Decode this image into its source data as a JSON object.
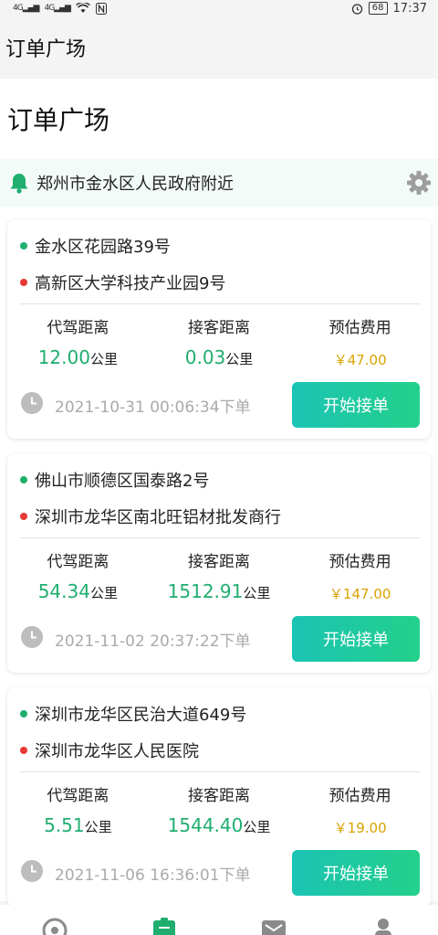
{
  "status": {
    "net1": "4G",
    "net2": "4G",
    "battery": "68",
    "time": "17:37"
  },
  "appbar": {
    "title": "订单广场"
  },
  "page": {
    "title": "订单广场"
  },
  "location": {
    "text": "郑州市金水区人民政府附近"
  },
  "labels": {
    "drive_distance": "代驾距离",
    "pickup_distance": "接客距离",
    "estimated_fee": "预估费用",
    "unit": "公里",
    "accept": "开始接单"
  },
  "orders": [
    {
      "from": "金水区花园路39号",
      "to": "高新区大学科技产业园9号",
      "drive": "12.00",
      "pickup": "0.03",
      "fee": "￥47.00",
      "time": "2021-10-31 00:06:34下单"
    },
    {
      "from": "佛山市顺德区国泰路2号",
      "to": "深圳市龙华区南北旺铝材批发商行",
      "drive": "54.34",
      "pickup": "1512.91",
      "fee": "￥147.00",
      "time": "2021-11-02 20:37:22下单"
    },
    {
      "from": "深圳市龙华区民治大道649号",
      "to": "深圳市龙华区人民医院",
      "drive": "5.51",
      "pickup": "1544.40",
      "fee": "￥19.00",
      "time": "2021-11-06 16:36:01下单"
    }
  ],
  "colors": {
    "accent": "#1fae6e",
    "fee": "#d9a300",
    "button_start": "#1bc4b4",
    "button_end": "#23d08a",
    "danger": "#e53935"
  },
  "icons": [
    "bell-icon",
    "gear-icon",
    "clock-icon",
    "tab-home-icon",
    "tab-orders-icon",
    "tab-message-icon",
    "tab-profile-icon"
  ]
}
